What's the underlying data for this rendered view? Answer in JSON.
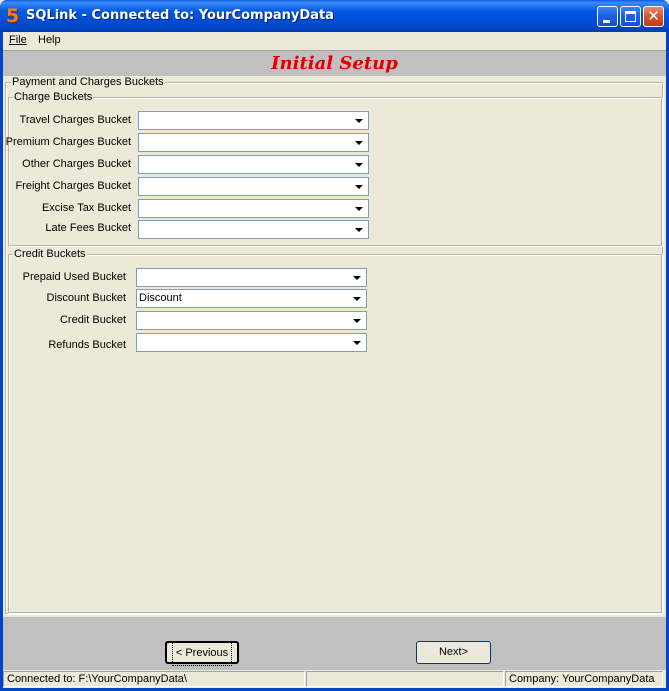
{
  "window": {
    "title": "SQLink - Connected to: YourCompanyData",
    "app_icon_glyph": "5",
    "accent_color": "#0054e3"
  },
  "menu": {
    "items": [
      {
        "label": "File"
      },
      {
        "label": "Help"
      }
    ]
  },
  "header": {
    "title": "Initial Setup",
    "title_color": "#e00000"
  },
  "outer_group": {
    "title": "Payment and Charges Buckets"
  },
  "charge_buckets": {
    "title": "Charge Buckets",
    "rows": [
      {
        "label": "Travel Charges Bucket",
        "value": ""
      },
      {
        "label": "Premium Charges Bucket",
        "value": ""
      },
      {
        "label": "Other Charges Bucket",
        "value": ""
      },
      {
        "label": "Freight Charges Bucket",
        "value": ""
      },
      {
        "label": "Excise Tax Bucket",
        "value": ""
      },
      {
        "label": "Late Fees Bucket",
        "value": ""
      }
    ]
  },
  "credit_buckets": {
    "title": "Credit Buckets",
    "rows": [
      {
        "label": "Prepaid Used Bucket",
        "value": ""
      },
      {
        "label": "Discount Bucket",
        "value": "Discount"
      },
      {
        "label": "Credit Bucket",
        "value": ""
      },
      {
        "label": "Refunds Bucket",
        "value": ""
      }
    ]
  },
  "buttons": {
    "previous": "< Previous",
    "next": "Next>"
  },
  "status": {
    "connected": "Connected to: F:\\YourCompanyData\\",
    "middle": "",
    "company": "Company: YourCompanyData"
  },
  "icons": {
    "minimize": "minimize-icon",
    "maximize": "maximize-icon",
    "close": "close-icon",
    "dropdown": "chevron-down-icon"
  }
}
